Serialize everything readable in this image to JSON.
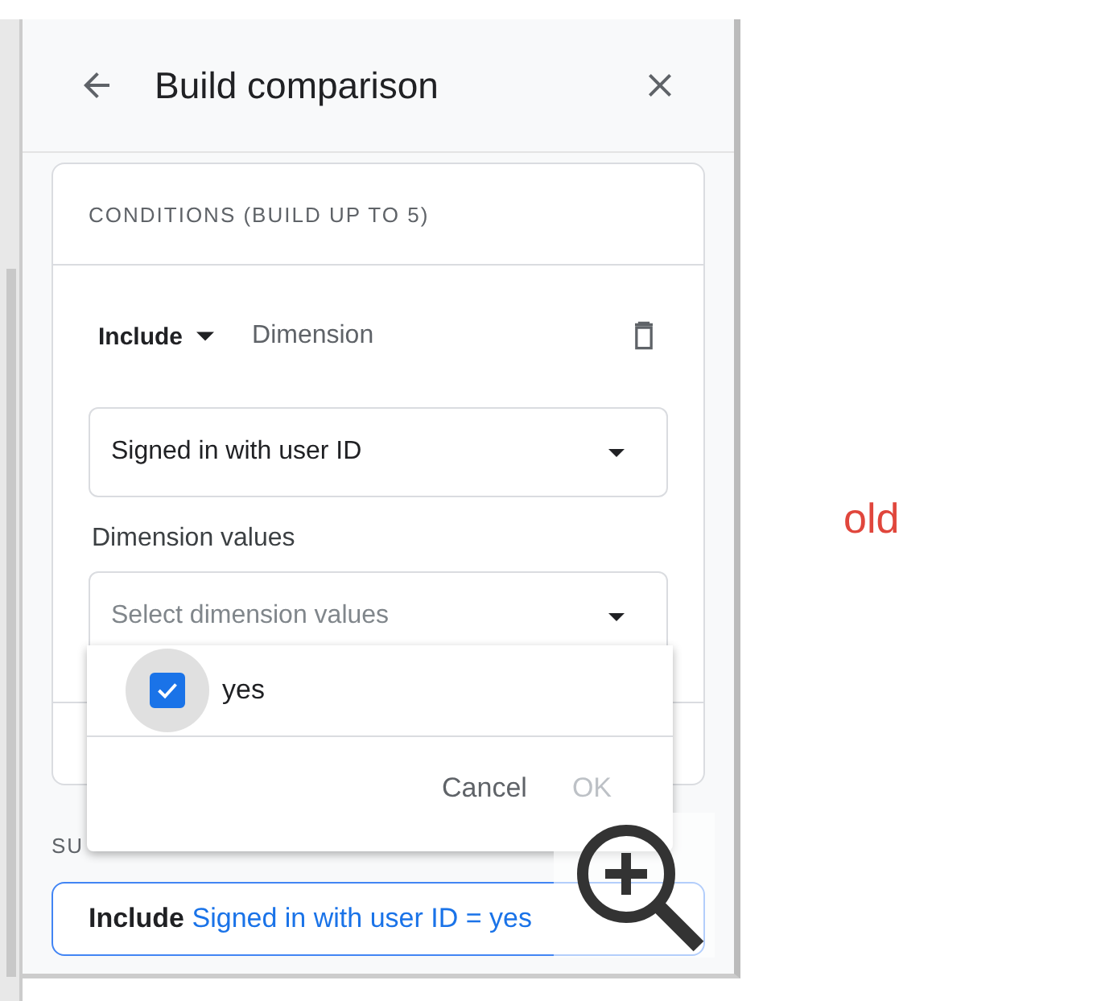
{
  "panel": {
    "title": "Build comparison"
  },
  "conditions": {
    "heading": "CONDITIONS (BUILD UP TO 5)",
    "mode": "Include",
    "field_label": "Dimension",
    "dimension": "Signed in with user ID",
    "values_label": "Dimension values",
    "values_placeholder": "Select dimension values"
  },
  "popup": {
    "options": [
      {
        "label": "yes",
        "checked": true
      }
    ],
    "buttons": [
      {
        "label": "Cancel",
        "disabled": false
      },
      {
        "label": "OK",
        "disabled": true
      }
    ]
  },
  "summary": {
    "heading": "SU",
    "mode": "Include",
    "condition": "Signed in with user ID = yes"
  },
  "annotation": "old"
}
